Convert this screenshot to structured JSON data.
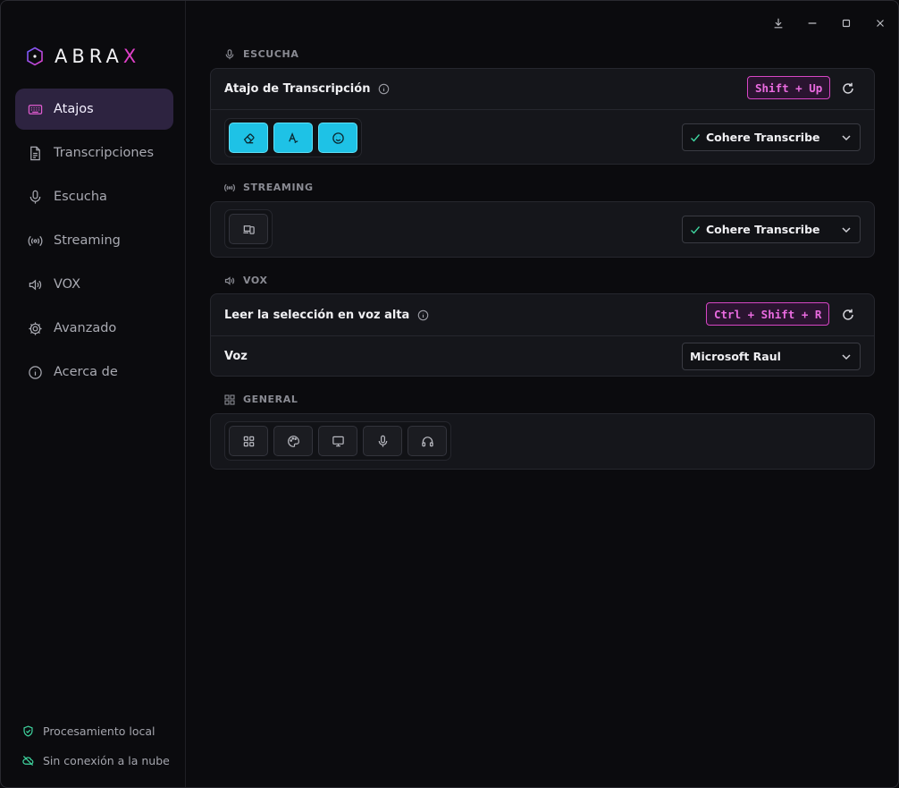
{
  "app": {
    "name_main": "ABRA",
    "name_accent": "X"
  },
  "window_controls": [
    "download-icon",
    "minimize-icon",
    "maximize-icon",
    "close-icon"
  ],
  "sidebar": {
    "items": [
      {
        "label": "Atajos",
        "icon": "keyboard-icon",
        "active": true
      },
      {
        "label": "Transcripciones",
        "icon": "document-icon",
        "active": false
      },
      {
        "label": "Escucha",
        "icon": "microphone-icon",
        "active": false
      },
      {
        "label": "Streaming",
        "icon": "broadcast-icon",
        "active": false
      },
      {
        "label": "VOX",
        "icon": "speaker-icon",
        "active": false
      },
      {
        "label": "Avanzado",
        "icon": "gear-icon",
        "active": false
      },
      {
        "label": "Acerca de",
        "icon": "info-icon",
        "active": false
      }
    ],
    "footer": [
      {
        "label": "Procesamiento local",
        "icon": "shield-check-icon"
      },
      {
        "label": "Sin conexión a la nube",
        "icon": "cloud-off-icon"
      }
    ]
  },
  "sections": {
    "escucha": {
      "label": "ESCUCHA",
      "shortcut_title": "Atajo de Transcripción",
      "shortcut_keys": "Shift + Up",
      "model_select": "Cohere Transcribe",
      "mode_buttons": [
        "eraser-icon",
        "text-format-icon",
        "smiley-icon"
      ]
    },
    "streaming": {
      "label": "STREAMING",
      "mode_buttons": [
        "devices-icon"
      ],
      "model_select": "Cohere Transcribe"
    },
    "vox": {
      "label": "VOX",
      "shortcut_title": "Leer la selección en voz alta",
      "shortcut_keys": "Ctrl + Shift + R",
      "voice_label": "Voz",
      "voice_select": "Microsoft Raul"
    },
    "general": {
      "label": "GENERAL",
      "buttons": [
        "grid-icon",
        "palette-icon",
        "monitor-icon",
        "microphone-icon",
        "headphones-icon"
      ]
    }
  },
  "colors": {
    "accent": "#e040c8",
    "active_bg": "#2d2340",
    "cyan": "#1ec2e6",
    "success": "#3fd6a0"
  }
}
